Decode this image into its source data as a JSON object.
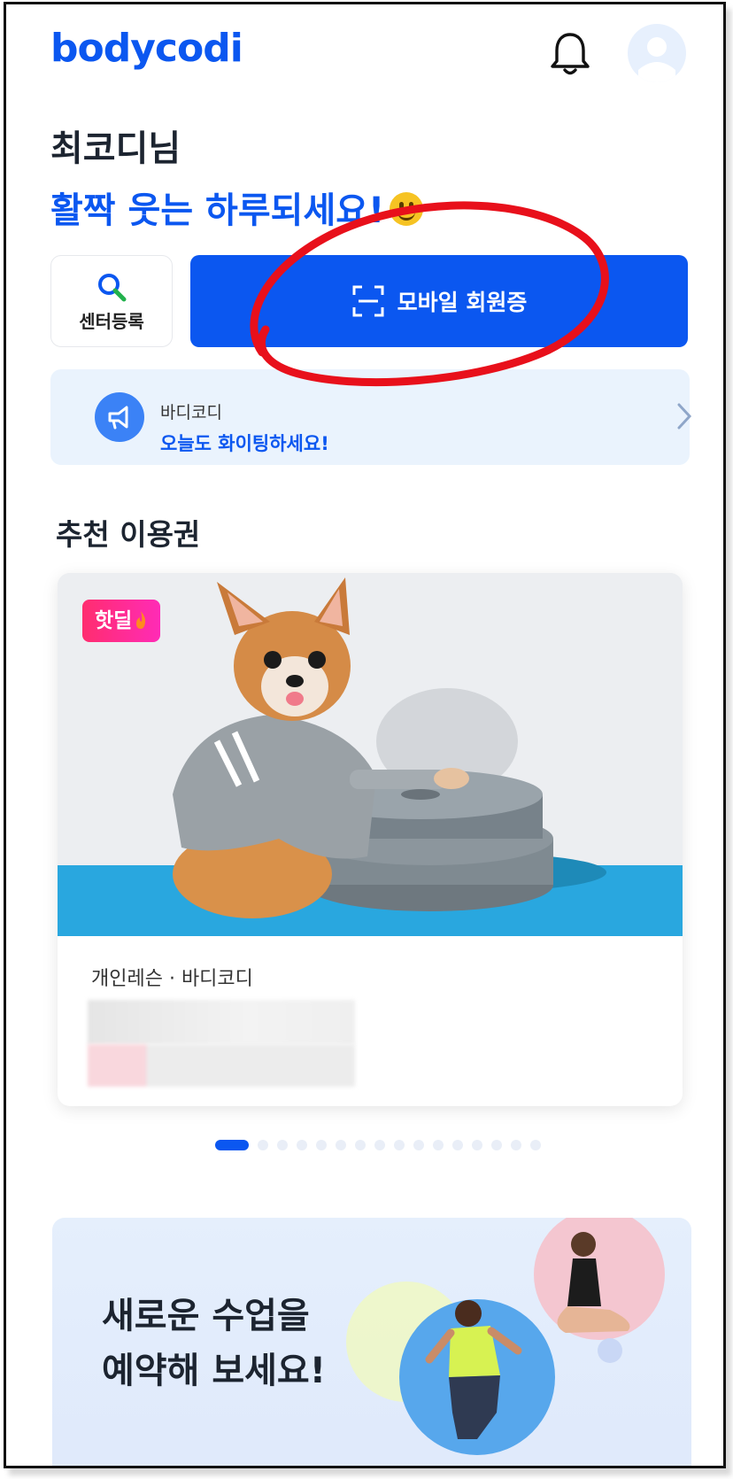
{
  "app": {
    "logo_text": "bodycodi",
    "brand_color": "#0b57f0"
  },
  "header": {
    "bell_icon": "bell-icon",
    "avatar_icon": "avatar-icon"
  },
  "greeting": {
    "name": "최코디님",
    "message": "활짝 웃는 하루되세요!"
  },
  "actions": {
    "center_register_label": "센터등록",
    "mobile_card_label": "모바일 회원증"
  },
  "notice": {
    "sender": "바디코디",
    "text": "오늘도 화이팅하세요!"
  },
  "recommended": {
    "title": "추천 이용권",
    "card": {
      "badge": "핫딜",
      "category": "개인레슨 · 바디코디"
    },
    "pagination": {
      "total": 16,
      "active_index": 0
    }
  },
  "promo": {
    "line1": "새로운 수업을",
    "line2": "예약해 보세요!"
  },
  "colors": {
    "accent": "#0b57f0",
    "badge_pink": "#ff2d8a",
    "notice_bg": "#eaf3fd",
    "annotation_red": "#e8101b"
  }
}
